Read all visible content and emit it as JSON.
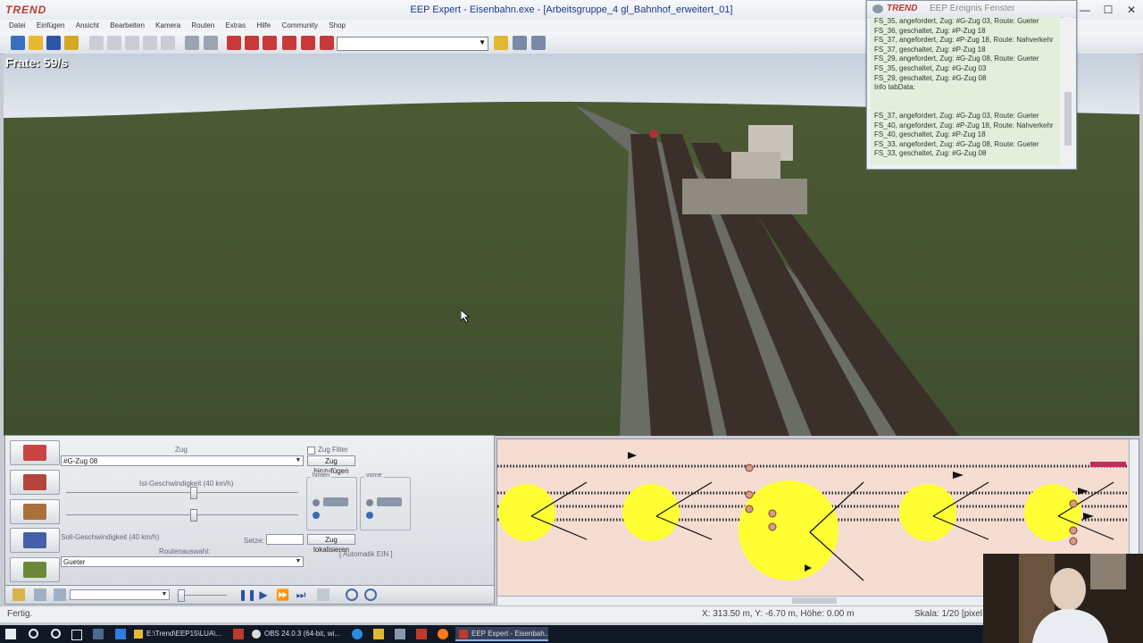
{
  "titlebar": {
    "logo": "TREND",
    "title": "EEP Expert - Eisenbahn.exe - [Arbeitsgruppe_4 gl_Bahnhof_erweitert_01]",
    "minimize": "—",
    "maximize": "☐",
    "close": "✕"
  },
  "menu": [
    "Datei",
    "Einfügen",
    "Ansicht",
    "Bearbeiten",
    "Kamera",
    "Routen",
    "Extras",
    "Hilfe",
    "Community",
    "Shop"
  ],
  "scene": {
    "frate": "Frate: 59/s"
  },
  "event_window": {
    "logo": "TREND",
    "title": "EEP Ereignis Fenster",
    "lines": [
      "FS_35, angefordert, Zug: #G-Zug 03, Route: Gueter",
      "FS_36,  geschaltet, Zug: #P-Zug 18",
      "FS_37, angefordert, Zug: #P-Zug 18, Route: Nahverkehr",
      "FS_37,  geschaltet, Zug: #P-Zug 18",
      "FS_29, angefordert, Zug: #G-Zug 08, Route: Gueter",
      "FS_35,  geschaltet, Zug: #G-Zug 03",
      "FS_29,  geschaltet, Zug: #G-Zug 08",
      "Info tabData:",
      "",
      "",
      "FS_37, angefordert, Zug: #G-Zug 03, Route: Gueter",
      "FS_40, angefordert, Zug: #P-Zug 18, Route: Nahverkehr",
      "FS_40,  geschaltet, Zug: #P-Zug 18",
      "FS_33, angefordert, Zug: #G-Zug 08, Route: Gueter",
      "FS_33,  geschaltet, Zug: #G-Zug 08"
    ]
  },
  "control": {
    "zug_label": "Zug",
    "zug_filter": "Zug Filter",
    "zug_value": "#G-Zug 08",
    "zug_hinzufuegen": "Zug hinzufügen",
    "ist_geschw": "Ist-Geschwindigkeit (40 km/h)",
    "soll_geschw": "Soll-Geschwindigkeit (40 km/h)",
    "hinten": "hinten",
    "vorne": "vorne",
    "setze": "Setze:",
    "zug_lokalisieren": "Zug lokalisieren",
    "automatik": "[ Automatik EIN ]",
    "routenauswahl": "Routenauswahl:",
    "route_value": "Gueter"
  },
  "status": {
    "left": "Fertig.",
    "coords": "X: 313.50 m, Y: -6.70 m, Höhe: 0.00 m",
    "scale": "Skala: 1/20 [pixel"
  },
  "taskbar": [
    "E:\\Trend\\EEP15\\LUA\\...",
    "OBS 24.0.3 (64-bit, wi...",
    "EEP Expert - Eisenbah..."
  ],
  "colors": {
    "map_bg": "#f5ddd2",
    "signal_circle": "#ffff33",
    "event_bg": "#e3eedc",
    "title_text": "#1b3a8c"
  }
}
